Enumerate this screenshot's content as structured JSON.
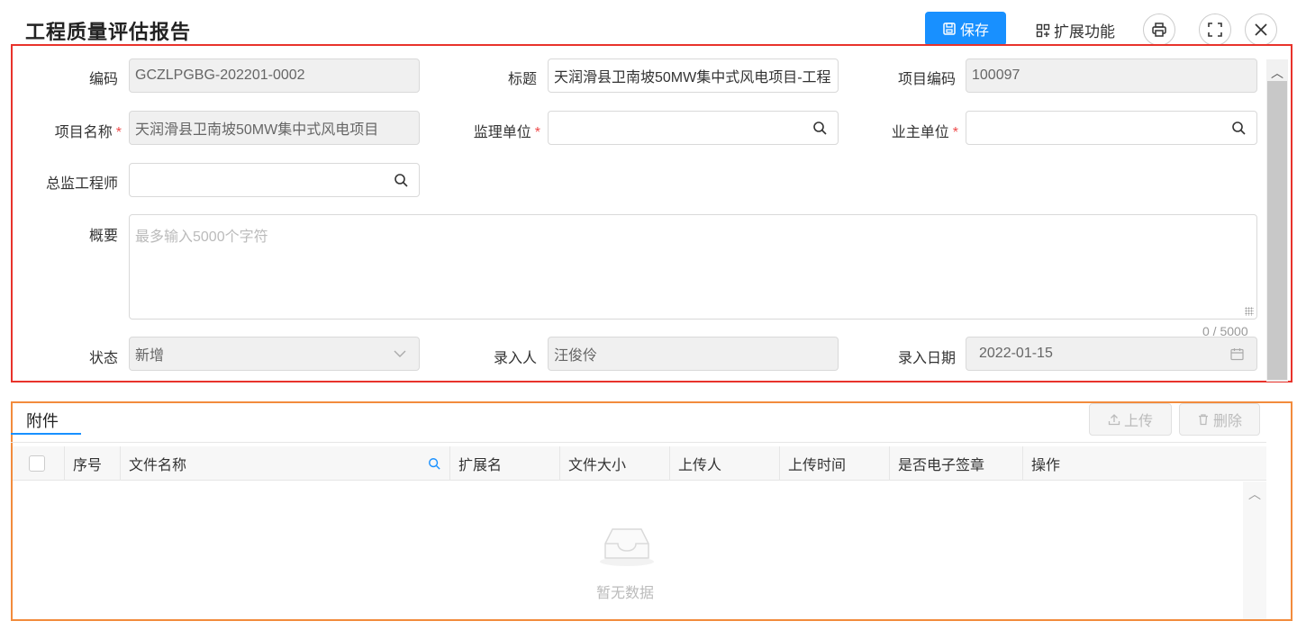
{
  "header": {
    "title": "工程质量评估报告",
    "save_label": "保存",
    "ext_label": "扩展功能"
  },
  "form": {
    "code": {
      "label": "编码",
      "value": "GCZLPGBG-202201-0002"
    },
    "title": {
      "label": "标题",
      "value": "天润滑县卫南坡50MW集中式风电项目-工程"
    },
    "project_code": {
      "label": "项目编码",
      "value": "100097"
    },
    "project_name": {
      "label": "项目名称",
      "value": "天润滑县卫南坡50MW集中式风电项目",
      "required": "*"
    },
    "supervisor_unit": {
      "label": "监理单位",
      "value": "",
      "required": "*"
    },
    "owner_unit": {
      "label": "业主单位",
      "value": "",
      "required": "*"
    },
    "chief_engineer": {
      "label": "总监工程师",
      "value": ""
    },
    "summary": {
      "label": "概要",
      "placeholder": "最多输入5000个字符",
      "counter": "0 / 5000"
    },
    "status": {
      "label": "状态",
      "value": "新增"
    },
    "entered_by": {
      "label": "录入人",
      "value": "汪俊伶"
    },
    "entry_date": {
      "label": "录入日期",
      "value": "2022-01-15"
    }
  },
  "attachments": {
    "tab_label": "附件",
    "upload_label": "上传",
    "delete_label": "删除",
    "columns": [
      "序号",
      "文件名称",
      "扩展名",
      "文件大小",
      "上传人",
      "上传时间",
      "是否电子签章",
      "操作"
    ],
    "empty_text": "暂无数据"
  },
  "colors": {
    "primary": "#1890ff",
    "form_border": "#e8332b",
    "attach_border": "#f28b3c",
    "required": "#ee4b4b"
  },
  "icons": [
    "save-icon",
    "extend-icon",
    "print-icon",
    "fullscreen-icon",
    "close-icon",
    "search-icon",
    "chevron-down-icon",
    "calendar-icon",
    "upload-icon",
    "delete-icon",
    "empty-inbox-icon"
  ]
}
